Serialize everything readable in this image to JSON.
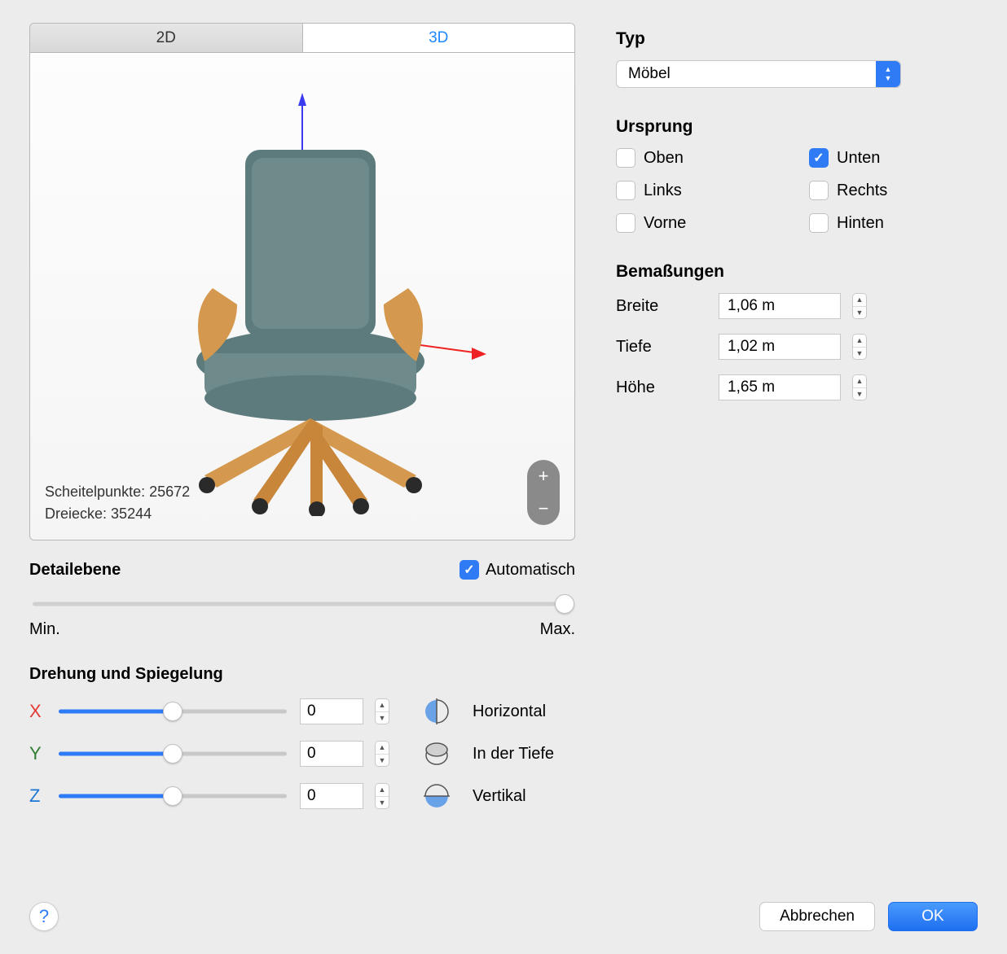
{
  "tabs": {
    "tab2d": "2D",
    "tab3d": "3D"
  },
  "viewport": {
    "vertices_label": "Scheitelpunkte:",
    "vertices_value": "25672",
    "triangles_label": "Dreiecke:",
    "triangles_value": "35244"
  },
  "detail": {
    "header": "Detailebene",
    "auto_label": "Automatisch",
    "auto_checked": true,
    "min": "Min.",
    "max": "Max.",
    "slider_percent": 98
  },
  "rotation": {
    "header": "Drehung und Spiegelung",
    "axes": [
      {
        "label": "X",
        "class": "axis-x",
        "value": "0",
        "slider_percent": 50
      },
      {
        "label": "Y",
        "class": "axis-y",
        "value": "0",
        "slider_percent": 50
      },
      {
        "label": "Z",
        "class": "axis-z",
        "value": "0",
        "slider_percent": 50
      }
    ],
    "mirrors": [
      {
        "label": "Horizontal"
      },
      {
        "label": "In der Tiefe"
      },
      {
        "label": "Vertikal"
      }
    ]
  },
  "typ": {
    "header": "Typ",
    "value": "Möbel"
  },
  "origin": {
    "header": "Ursprung",
    "items": [
      {
        "label": "Oben",
        "checked": false
      },
      {
        "label": "Unten",
        "checked": true
      },
      {
        "label": "Links",
        "checked": false
      },
      {
        "label": "Rechts",
        "checked": false
      },
      {
        "label": "Vorne",
        "checked": false
      },
      {
        "label": "Hinten",
        "checked": false
      }
    ]
  },
  "dims": {
    "header": "Bemaßungen",
    "rows": [
      {
        "label": "Breite",
        "value": "1,06 m"
      },
      {
        "label": "Tiefe",
        "value": "1,02 m"
      },
      {
        "label": "Höhe",
        "value": "1,65 m"
      }
    ]
  },
  "footer": {
    "cancel": "Abbrechen",
    "ok": "OK"
  }
}
